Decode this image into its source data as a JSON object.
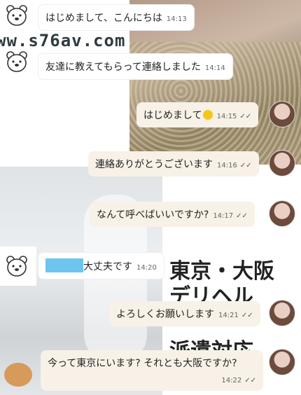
{
  "watermark": "ww.s76av.com",
  "background_text": {
    "line1": "東京・大阪",
    "line2": "デリヘル",
    "line3": "派遣対応"
  },
  "messages": [
    {
      "text": "はじめまして、こんにちは",
      "time": "14:13",
      "side": "in"
    },
    {
      "text": "友達に教えてもらって連絡しました",
      "time": "14:14",
      "side": "in"
    },
    {
      "text": "はじめまして",
      "time": "14:15",
      "side": "out",
      "emoji": "smiling-face"
    },
    {
      "text": "連絡ありがとうございます",
      "time": "14:16",
      "side": "out"
    },
    {
      "text": "なんて呼べばいいですか?",
      "time": "14:17",
      "side": "out"
    },
    {
      "text": "大丈夫です",
      "time": "14:20",
      "side": "in",
      "redacted": true
    },
    {
      "text": "よろしくお願いします",
      "time": "14:21",
      "side": "out"
    },
    {
      "text": "今って東京にいます? それとも大阪ですか?",
      "time": "14:22",
      "side": "out"
    }
  ],
  "read_ticks": "✓✓",
  "colors": {
    "outgoing_bubble": "#f7f1e7",
    "incoming_bubble": "#ffffff",
    "redaction": "#6cc5ee"
  }
}
